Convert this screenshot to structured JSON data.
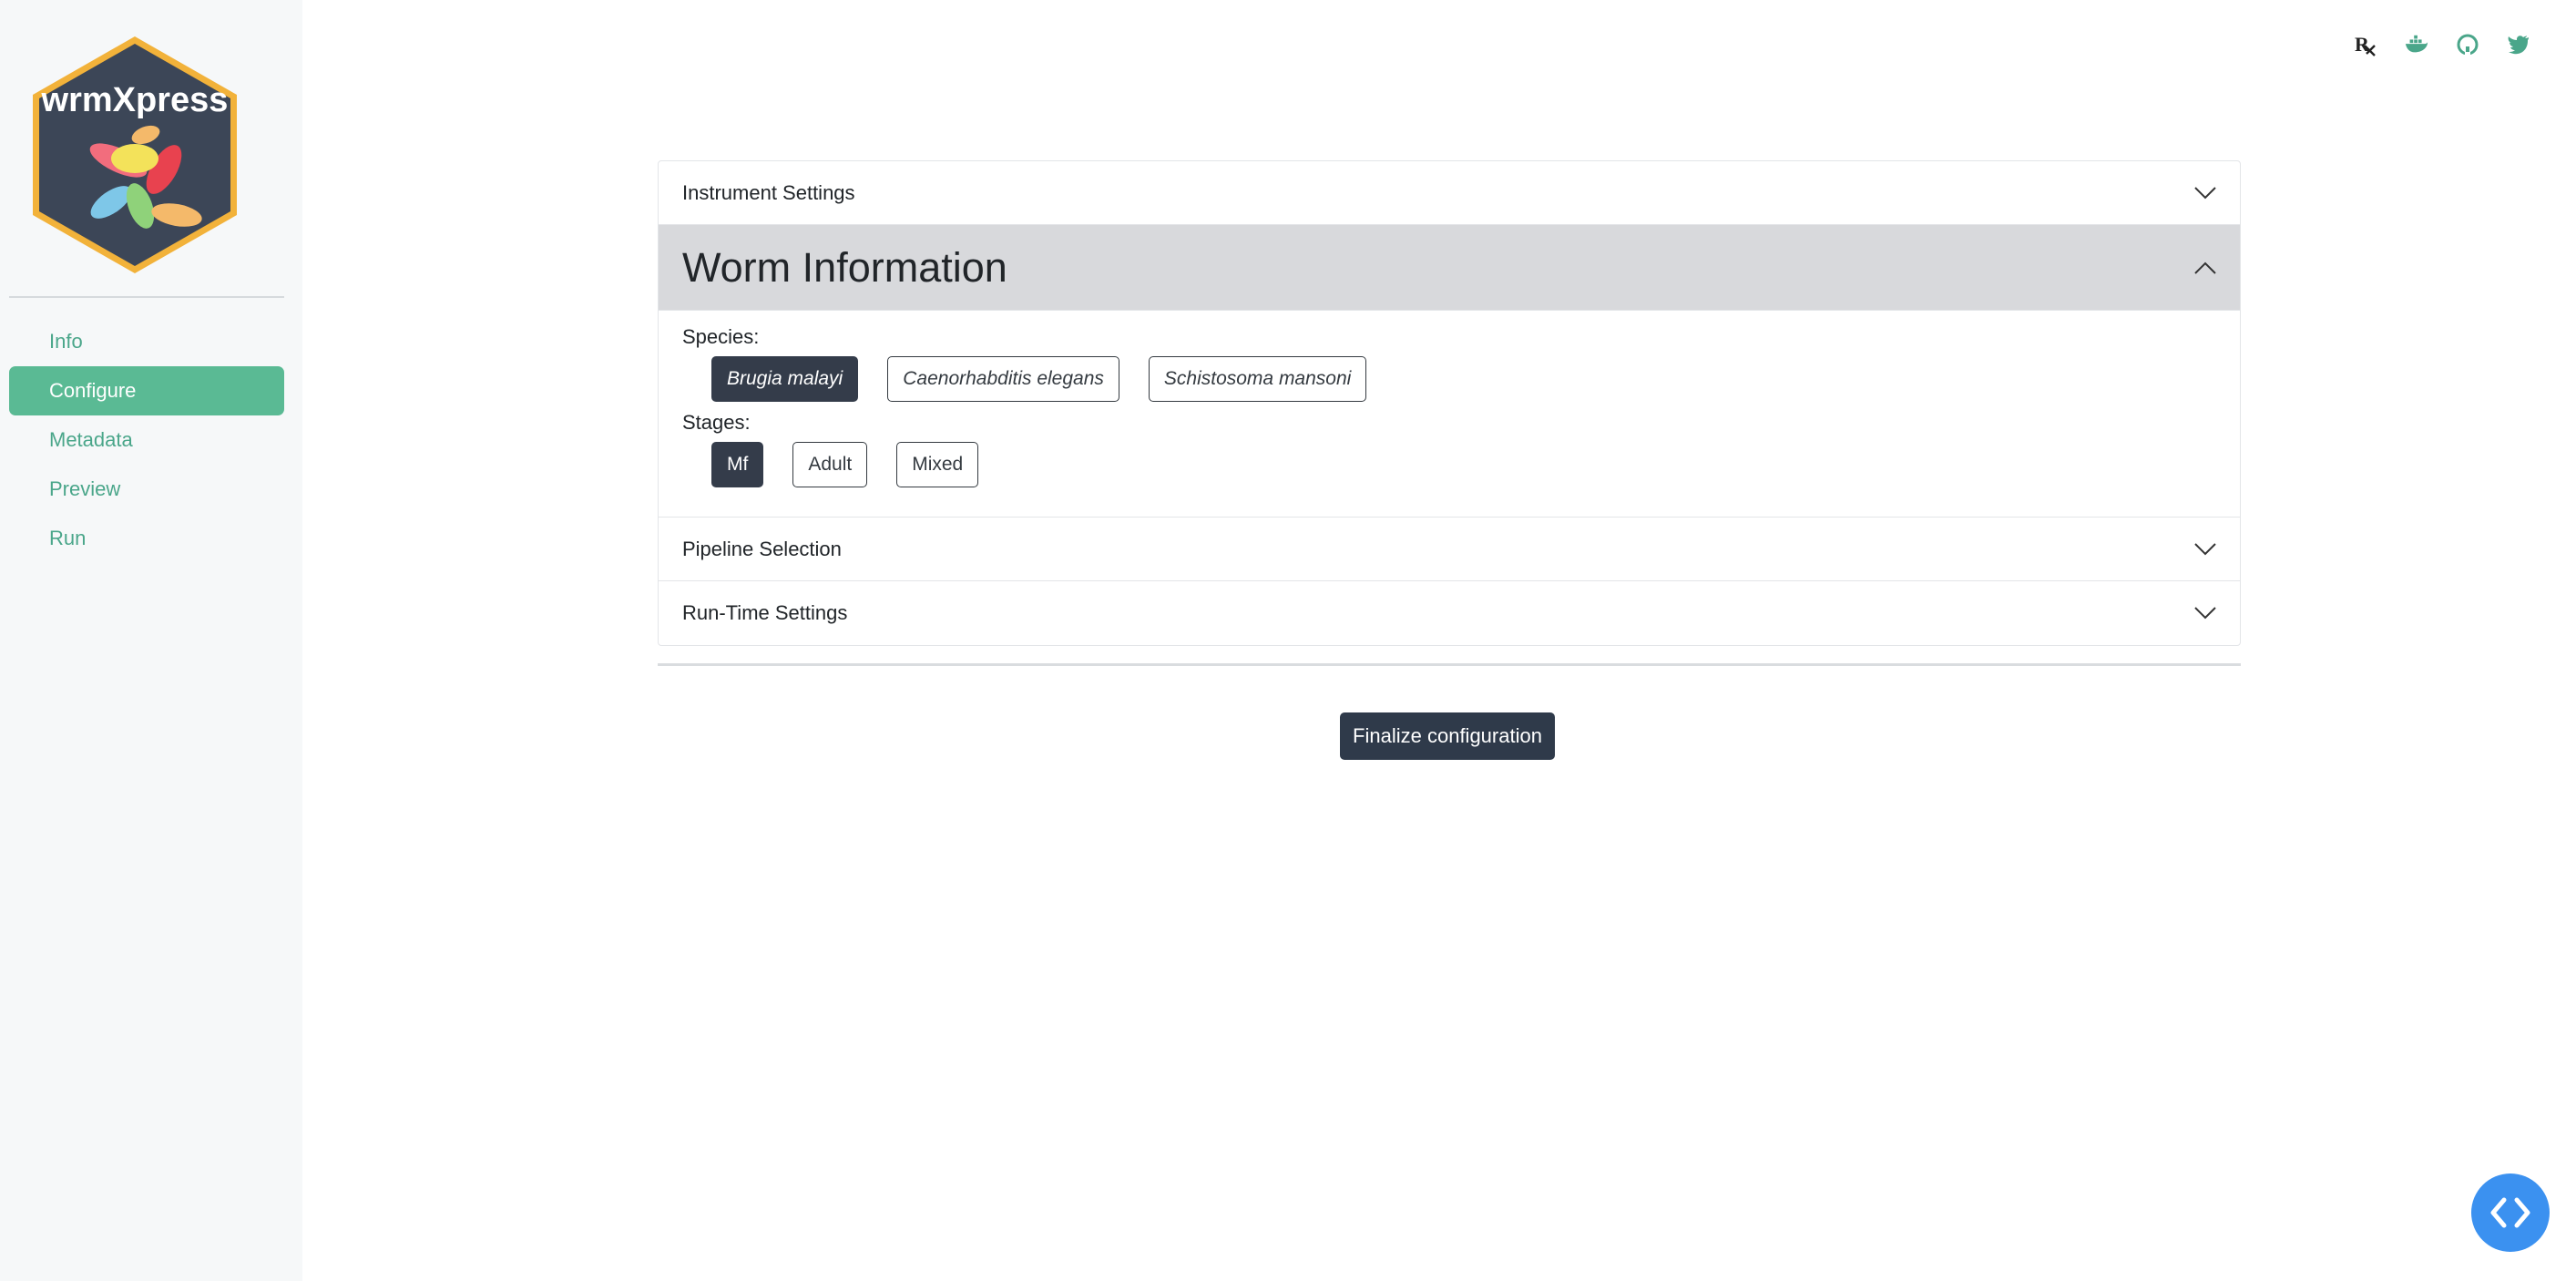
{
  "app": {
    "logo_text": "wrmXpress"
  },
  "sidebar": {
    "items": [
      {
        "label": "Info",
        "active": false
      },
      {
        "label": "Configure",
        "active": true
      },
      {
        "label": "Metadata",
        "active": false
      },
      {
        "label": "Preview",
        "active": false
      },
      {
        "label": "Run",
        "active": false
      }
    ]
  },
  "header_icons": [
    "rx-icon",
    "docker-icon",
    "github-icon",
    "twitter-icon"
  ],
  "accordion": {
    "instrument_settings": "Instrument Settings",
    "worm_information": "Worm Information",
    "pipeline_selection": "Pipeline Selection",
    "run_time_settings": "Run-Time Settings"
  },
  "worm_info": {
    "species_label": "Species:",
    "species": [
      "Brugia malayi",
      "Caenorhabditis elegans",
      "Schistosoma mansoni"
    ],
    "species_selected": "Brugia malayi",
    "stages_label": "Stages:",
    "stages": [
      "Mf",
      "Adult",
      "Mixed"
    ],
    "stages_selected": "Mf"
  },
  "actions": {
    "finalize_label": "Finalize configuration"
  },
  "colors": {
    "accent": "#5aba94",
    "nav_text": "#4aa68a",
    "dark_button": "#2f3a4a",
    "fab": "#3b91f0"
  }
}
